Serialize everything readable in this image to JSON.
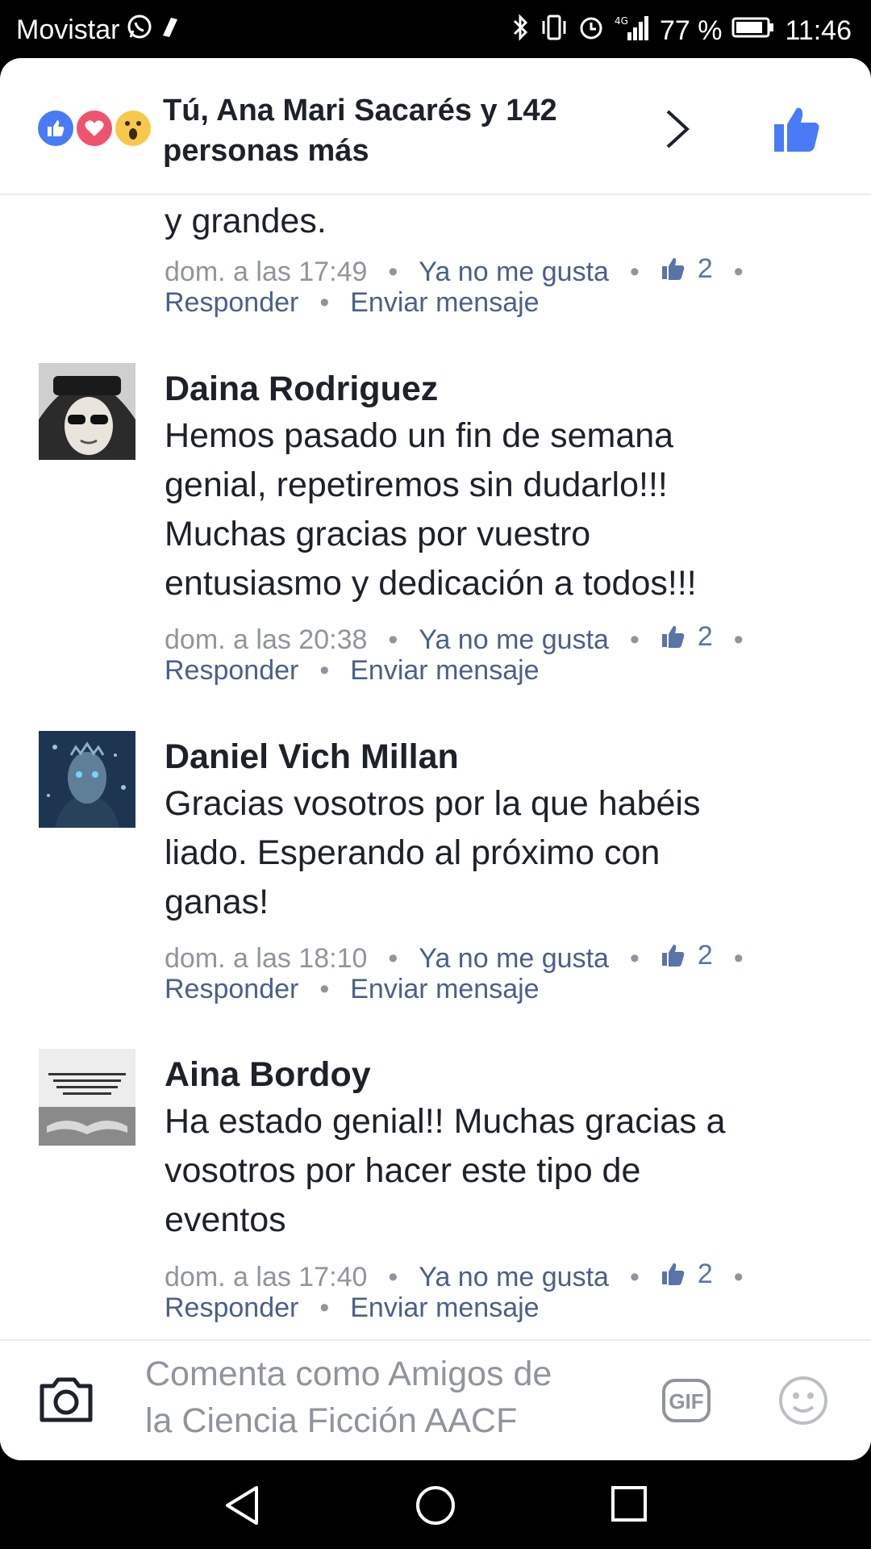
{
  "status_bar": {
    "carrier": "Movistar",
    "battery": "77 %",
    "time": "11:46",
    "network": "4G",
    "icons": [
      "whatsapp-icon",
      "notification-icon",
      "bluetooth-icon",
      "vibrate-icon",
      "alarm-icon",
      "signal-icon",
      "battery-icon"
    ]
  },
  "reactions": {
    "summary_line1": "Tú, Ana Mari Sacarés y 142",
    "summary_line2": "personas más",
    "icons": [
      "like-reaction-icon",
      "love-reaction-icon",
      "wow-reaction-icon"
    ]
  },
  "comments": [
    {
      "author": "",
      "text": "y grandes.",
      "timestamp": "dom. a las 17:49",
      "unlike_label": "Ya no me gusta",
      "like_count": "2",
      "reply_label": "Responder",
      "message_label": "Enviar mensaje"
    },
    {
      "author": "Daina Rodriguez",
      "text_lines": [
        "Hemos pasado un fin de semana",
        "genial, repetiremos sin dudarlo!!!",
        "Muchas gracias por vuestro",
        "entusiasmo y dedicación a todos!!!"
      ],
      "timestamp": "dom. a las 20:38",
      "unlike_label": "Ya no me gusta",
      "like_count": "2",
      "reply_label": "Responder",
      "message_label": "Enviar mensaje"
    },
    {
      "author": "Daniel Vich Millan",
      "text_lines": [
        "Gracias vosotros por la que habéis",
        "liado. Esperando al próximo con",
        "ganas!"
      ],
      "timestamp": "dom. a las 18:10",
      "unlike_label": "Ya no me gusta",
      "like_count": "2",
      "reply_label": "Responder",
      "message_label": "Enviar mensaje"
    },
    {
      "author": "Aina Bordoy",
      "text_lines": [
        "Ha estado genial!! Muchas gracias a",
        "vosotros por hacer este tipo de",
        "eventos"
      ],
      "timestamp": "dom. a las 17:40",
      "unlike_label": "Ya no me gusta",
      "like_count": "2",
      "reply_label": "Responder",
      "message_label": "Enviar mensaje",
      "avatar_text": "Tu vida es como un libro en el que a todos les está permitido ver el título, pero solo los que te aman llegan a ver el contenido."
    }
  ],
  "composer": {
    "placeholder_line1": "Comenta como Amigos de",
    "placeholder_line2": "la Ciencia Ficción AACF",
    "gif_label": "GIF"
  },
  "colors": {
    "link_blue": "#4b5f8a",
    "like_blue": "#4a7bf7",
    "meta_gray": "#90949c",
    "text_dark": "#1d2129"
  }
}
